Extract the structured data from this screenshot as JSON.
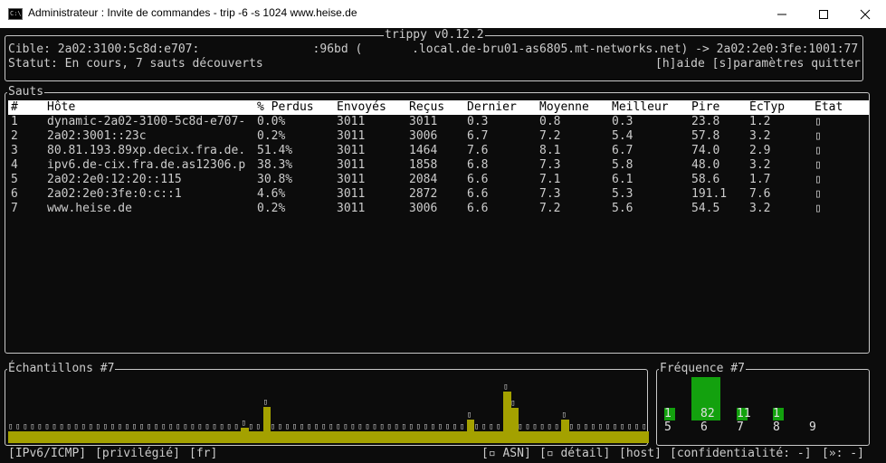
{
  "window": {
    "title": "Administrateur : Invite de commandes - trip  -6  -s 1024 www.heise.de",
    "icon": "console-icon",
    "icon_text": "C:\\"
  },
  "header": {
    "app_title": "trippy v0.12.2",
    "target_label": "Cible: 2a02:3100:5c8d:e707:                :96bd (       .local.de-bru01-as6805.mt-networks.net) -> 2a02:2e0:3fe:1001:77",
    "status_line": "Statut: En cours, 7 sauts découverts",
    "help_hint": "[h]aide [s]paramètres quitter"
  },
  "hops_panel": {
    "title": "Sauts",
    "columns": [
      "#",
      "Hôte",
      "% Perdus",
      "Envoyés",
      "Reçus",
      "Dernier",
      "Moyenne",
      "Meilleur",
      "Pire",
      "ÉcTyp",
      "État"
    ],
    "rows": [
      [
        "1",
        "dynamic-2a02-3100-5c8d-e707-",
        "0.0%",
        "3011",
        "3011",
        "0.3",
        "0.8",
        "0.3",
        "23.8",
        "1.2",
        "▯"
      ],
      [
        "2",
        "2a02:3001::23c",
        "0.2%",
        "3011",
        "3006",
        "6.7",
        "7.2",
        "5.4",
        "57.8",
        "3.2",
        "▯"
      ],
      [
        "3",
        "80.81.193.89xp.decix.fra.de.",
        "51.4%",
        "3011",
        "1464",
        "7.6",
        "8.1",
        "6.7",
        "74.0",
        "2.9",
        "▯"
      ],
      [
        "4",
        "ipv6.de-cix.fra.de.as12306.p",
        "38.3%",
        "3011",
        "1858",
        "6.8",
        "7.3",
        "5.8",
        "48.0",
        "3.2",
        "▯"
      ],
      [
        "5",
        "2a02:2e0:12:20::115",
        "30.8%",
        "3011",
        "2084",
        "6.6",
        "7.1",
        "6.1",
        "58.6",
        "1.7",
        "▯"
      ],
      [
        "6",
        "2a02:2e0:3fe:0:c::1",
        "4.6%",
        "3011",
        "2872",
        "6.6",
        "7.3",
        "5.3",
        "191.1",
        "7.6",
        "▯"
      ],
      [
        "7",
        "www.heise.de",
        "0.2%",
        "3011",
        "3006",
        "6.6",
        "7.2",
        "5.6",
        "54.5",
        "3.2",
        "▯"
      ]
    ]
  },
  "samples_panel": {
    "title": "Échantillons #7",
    "bar_color": "#a4a100",
    "marker_glyph": "▯",
    "samples": [
      0.22,
      0.22,
      0.22,
      0.22,
      0.22,
      0.22,
      0.22,
      0.22,
      0.22,
      0.22,
      0.22,
      0.22,
      0.22,
      0.22,
      0.22,
      0.22,
      0.22,
      0.22,
      0.22,
      0.22,
      0.22,
      0.22,
      0.22,
      0.22,
      0.22,
      0.22,
      0.22,
      0.22,
      0.22,
      0.22,
      0.22,
      0.22,
      0.3,
      0.22,
      0.22,
      0.7,
      0.22,
      0.22,
      0.22,
      0.22,
      0.22,
      0.22,
      0.22,
      0.22,
      0.22,
      0.22,
      0.22,
      0.22,
      0.22,
      0.22,
      0.22,
      0.22,
      0.22,
      0.22,
      0.22,
      0.22,
      0.22,
      0.22,
      0.22,
      0.22,
      0.22,
      0.22,
      0.22,
      0.45,
      0.22,
      0.22,
      0.22,
      0.22,
      1.0,
      0.68,
      0.22,
      0.22,
      0.22,
      0.22,
      0.22,
      0.22,
      0.45,
      0.22,
      0.22,
      0.22,
      0.22,
      0.22,
      0.22,
      0.22,
      0.22,
      0.22,
      0.22,
      0.22
    ]
  },
  "frequency_panel": {
    "title": "Fréquence #7",
    "bar_color": "#13a10e",
    "buckets": [
      {
        "label": "5",
        "count": "1",
        "value": 1
      },
      {
        "label": "6",
        "count": "82",
        "value": 82
      },
      {
        "label": "7",
        "count": "11",
        "value": 11
      },
      {
        "label": "8",
        "count": "1",
        "value": 1
      },
      {
        "label": "9",
        "count": "",
        "value": 0
      }
    ]
  },
  "statusbar": {
    "left": [
      "[IPv6/ICMP]",
      "[privilégié]",
      "[fr]"
    ],
    "right": [
      "[▫ ASN]",
      "[▫ détail]",
      "[host]",
      "[confidentialité: -]",
      "[»: -]"
    ]
  }
}
